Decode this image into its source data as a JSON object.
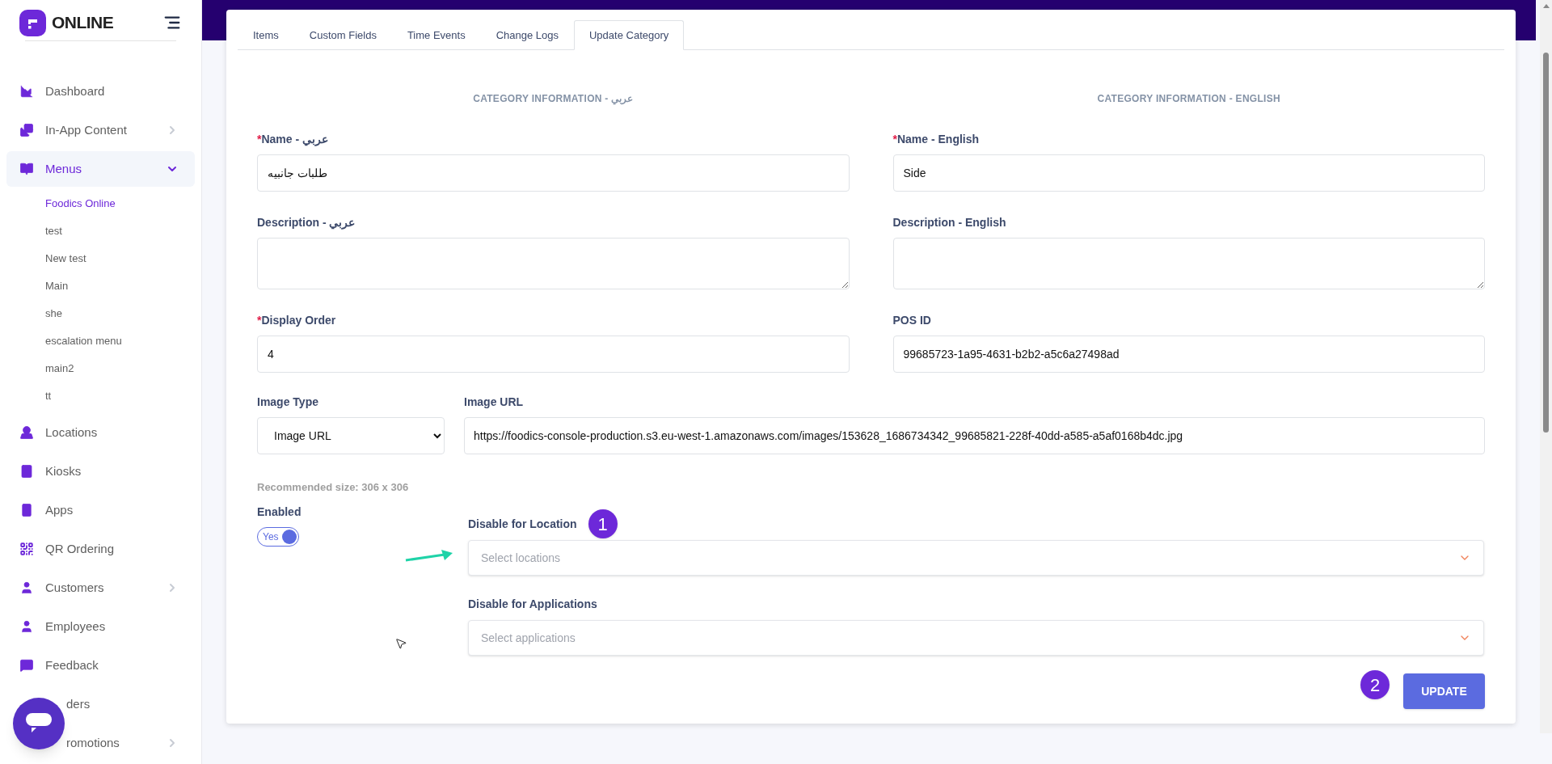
{
  "brand": {
    "name": "ONLINE"
  },
  "sidebar": {
    "items": [
      {
        "label": "Dashboard",
        "selected": false
      },
      {
        "label": "In-App Content",
        "selected": false,
        "expanded": false
      },
      {
        "label": "Menus",
        "selected": true,
        "expanded": true,
        "children": [
          {
            "label": "Foodics Online",
            "selected": true
          },
          {
            "label": "test",
            "selected": false
          },
          {
            "label": "New test",
            "selected": false
          },
          {
            "label": "Main",
            "selected": false
          },
          {
            "label": "she",
            "selected": false
          },
          {
            "label": "escalation menu",
            "selected": false
          },
          {
            "label": "main2",
            "selected": false
          },
          {
            "label": "tt",
            "selected": false
          }
        ]
      },
      {
        "label": "Locations",
        "selected": false
      },
      {
        "label": "Kiosks",
        "selected": false
      },
      {
        "label": "Apps",
        "selected": false
      },
      {
        "label": "QR Ordering",
        "selected": false
      },
      {
        "label": "Customers",
        "selected": false,
        "expanded": false
      },
      {
        "label": "Employees",
        "selected": false
      },
      {
        "label": "Feedback",
        "selected": false
      },
      {
        "label": "ders",
        "selected": false,
        "covered": true
      },
      {
        "label": "romotions",
        "selected": false,
        "expanded": false,
        "covered": true
      }
    ]
  },
  "tabs": [
    {
      "label": "Items",
      "selected": false
    },
    {
      "label": "Custom Fields",
      "selected": false
    },
    {
      "label": "Time Events",
      "selected": false
    },
    {
      "label": "Change Logs",
      "selected": false
    },
    {
      "label": "Update Category",
      "selected": true
    }
  ],
  "columns": [
    {
      "heading": "CATEGORY INFORMATION - عربي",
      "fields": [
        {
          "label": "Name - عربي",
          "required_mark": "*",
          "kind": "input",
          "value": "طلبات جانبيه"
        },
        {
          "label": "Description - عربي",
          "kind": "textarea"
        },
        {
          "label": "Display Order",
          "required_mark": "*",
          "kind": "input",
          "value": "4"
        }
      ]
    },
    {
      "heading": "CATEGORY INFORMATION - ENGLISH",
      "fields": [
        {
          "label": "Name - English",
          "required_mark": "*",
          "kind": "input",
          "value": "Side"
        },
        {
          "label": "Description - English",
          "kind": "textarea"
        },
        {
          "label": "POS ID",
          "kind": "input",
          "value": "99685723-1a95-4631-b2b2-a5c6a27498ad"
        }
      ]
    }
  ],
  "image_type": {
    "label": "Image Type",
    "value": "Image URL"
  },
  "image_url": {
    "label": "Image URL",
    "value": "https://foodics-console-production.s3.eu-west-1.amazonaws.com/images/153628_1686734342_99685821-228f-40dd-a585-a5af0168b4dc.jpg"
  },
  "hint": "Recommended size: 306 x 306",
  "enabled": {
    "label": "Enabled",
    "on": true,
    "text": "Yes"
  },
  "disable_location": {
    "label": "Disable for Location",
    "placeholder": "Select locations",
    "step": "1"
  },
  "disable_applications": {
    "label": "Disable for Applications",
    "placeholder": "Select applications"
  },
  "update_button": {
    "label": "UPDATE",
    "step": "2"
  }
}
